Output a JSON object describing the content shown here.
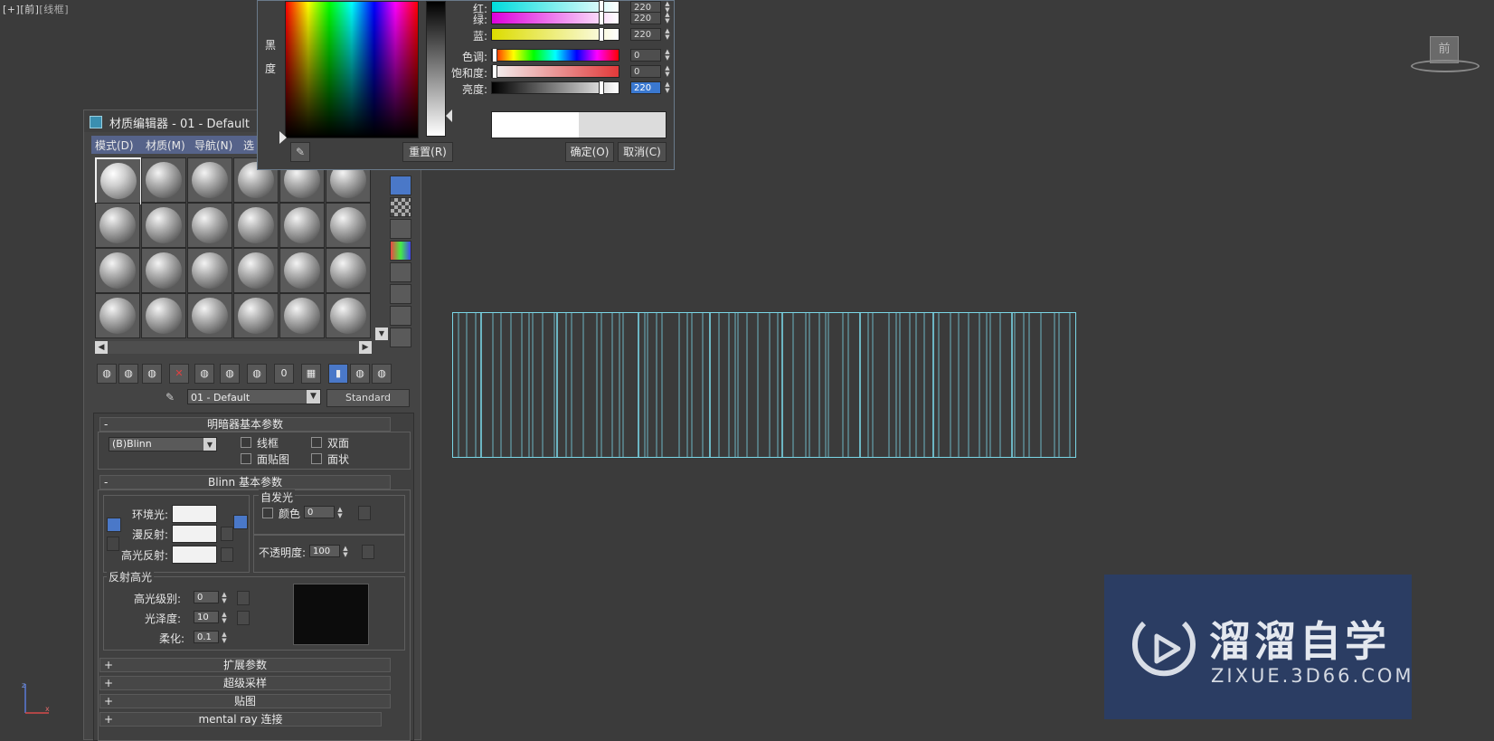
{
  "viewport": {
    "label_bracket_plus": "[+]",
    "label_bracket_view": "[前]",
    "label_bracket_mode": "[线框]",
    "viewcube_face": "前"
  },
  "watermark": {
    "title": "溜溜自学",
    "subtitle": "ZIXUE.3D66.COM"
  },
  "material_editor": {
    "title": "材质编辑器 - 01 - Default",
    "menu": [
      "模式(D)",
      "材质(M)",
      "导航(N)",
      "选"
    ],
    "material_name": "01 - Default",
    "material_type": "Standard",
    "rollouts": {
      "shader_basic": "明暗器基本参数",
      "shader_type": "(B)Blinn",
      "opt_wire": "线框",
      "opt_two_sided": "双面",
      "opt_face_map": "面贴图",
      "opt_faceted": "面状",
      "blinn_basic": "Blinn 基本参数",
      "ambient_label": "环境光:",
      "diffuse_label": "漫反射:",
      "specular_label": "高光反射:",
      "self_illum_group": "自发光",
      "self_illum_color_label": "颜色",
      "self_illum_value": "0",
      "opacity_label": "不透明度:",
      "opacity_value": "100",
      "specular_highlights_group": "反射高光",
      "specular_level_label": "高光级别:",
      "specular_level_value": "0",
      "glossiness_label": "光泽度:",
      "glossiness_value": "10",
      "soften_label": "柔化:",
      "soften_value": "0.1",
      "extended": "扩展参数",
      "supersampling": "超级采样",
      "maps": "贴图",
      "mental_ray": "mental ray 连接"
    }
  },
  "color_picker": {
    "side_label_1": "黑",
    "side_label_2": "度",
    "red_label": "红:",
    "green_label": "绿:",
    "blue_label": "蓝:",
    "hue_label": "色调:",
    "sat_label": "饱和度:",
    "value_label": "亮度:",
    "red_value": "220",
    "green_value": "220",
    "blue_value": "220",
    "hue_value": "0",
    "sat_value": "0",
    "value_value": "220",
    "reset_button": "重置(R)",
    "ok_button": "确定(O)",
    "cancel_button": "取消(C)"
  },
  "colors": {
    "wireframe": "#7ad6e6",
    "viewport_bg": "#3b3b3b",
    "menu_bar": "#56638a",
    "watermark_bg": "#2b3d63"
  }
}
